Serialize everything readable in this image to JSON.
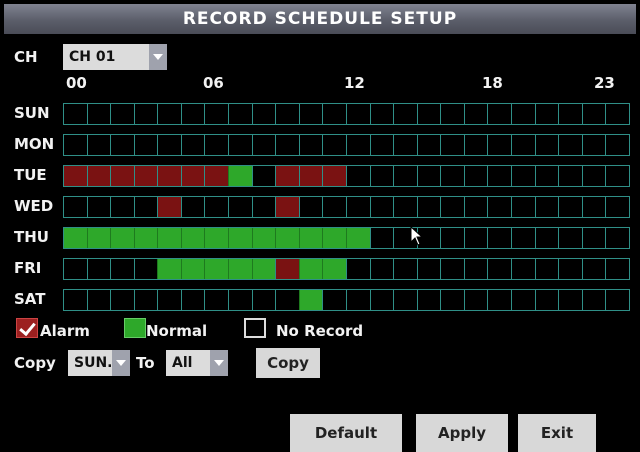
{
  "title": "RECORD SCHEDULE SETUP",
  "channel": {
    "label": "CH",
    "value": "CH 01"
  },
  "hour_labels": [
    "00",
    "06",
    "12",
    "18",
    "23"
  ],
  "days": [
    {
      "label": "SUN",
      "cells": "NNNNNNNNNNNNNNNNNNNNNNNN"
    },
    {
      "label": "MON",
      "cells": "NNNNNNNNNNNNNNNNNNNNNNNN"
    },
    {
      "label": "TUE",
      "cells": "AAAAAAAGNAAANNNNNNNNNNNN"
    },
    {
      "label": "WED",
      "cells": "NNNNANNNNANNNNNNNNNNNNNN"
    },
    {
      "label": "THU",
      "cells": "GGGGGGGGGGGGGNNNNNNNNNNN"
    },
    {
      "label": "FRI",
      "cells": "NNNNGGGGGAGGNNNNNNNNNNNN"
    },
    {
      "label": "SAT",
      "cells": "NNNNNNNNNNGNNNNNNNNNNNNN"
    }
  ],
  "legend": {
    "alarm": "Alarm",
    "normal": "Normal",
    "no_record": "No Record"
  },
  "copy": {
    "label": "Copy",
    "from": "SUN.",
    "to_label": "To",
    "to": "All",
    "button": "Copy"
  },
  "buttons": {
    "default": "Default",
    "apply": "Apply",
    "exit": "Exit"
  },
  "colors": {
    "normal": "#2ea82a",
    "alarm": "#7a1212",
    "grid": "#2f8f87",
    "title_bar": "#5b5e6a"
  }
}
